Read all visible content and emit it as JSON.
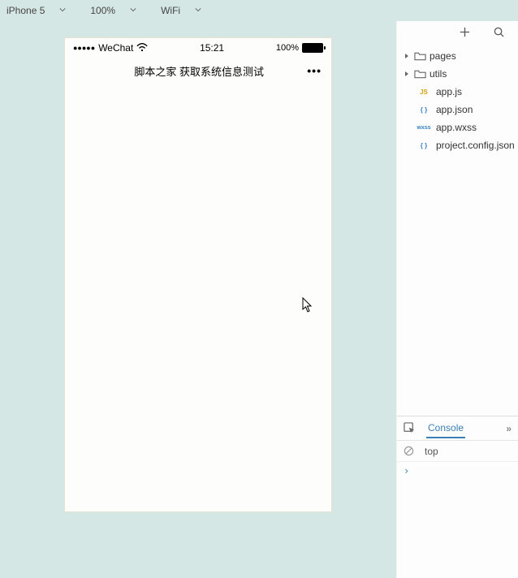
{
  "toolbar": {
    "device": "iPhone 5",
    "zoom": "100%",
    "network": "WiFi"
  },
  "simulator": {
    "status": {
      "signal": "●●●●●",
      "carrier": "WeChat",
      "time": "15:21",
      "battery_pct": "100%"
    },
    "nav": {
      "title": "脚本之家 获取系统信息测试",
      "menu": "•••"
    }
  },
  "sidebar": {
    "folders": [
      {
        "name": "pages"
      },
      {
        "name": "utils"
      }
    ],
    "files": [
      {
        "badge": "JS",
        "badgeClass": "js-badge",
        "name": "app.js"
      },
      {
        "badge": "{ }",
        "badgeClass": "json-badge",
        "name": "app.json"
      },
      {
        "badge": "wxss",
        "badgeClass": "wxss-badge",
        "name": "app.wxss"
      },
      {
        "badge": "{ }",
        "badgeClass": "json-badge",
        "name": "project.config.json"
      }
    ]
  },
  "console": {
    "tab": "Console",
    "filter": "top",
    "prompt": "›"
  }
}
